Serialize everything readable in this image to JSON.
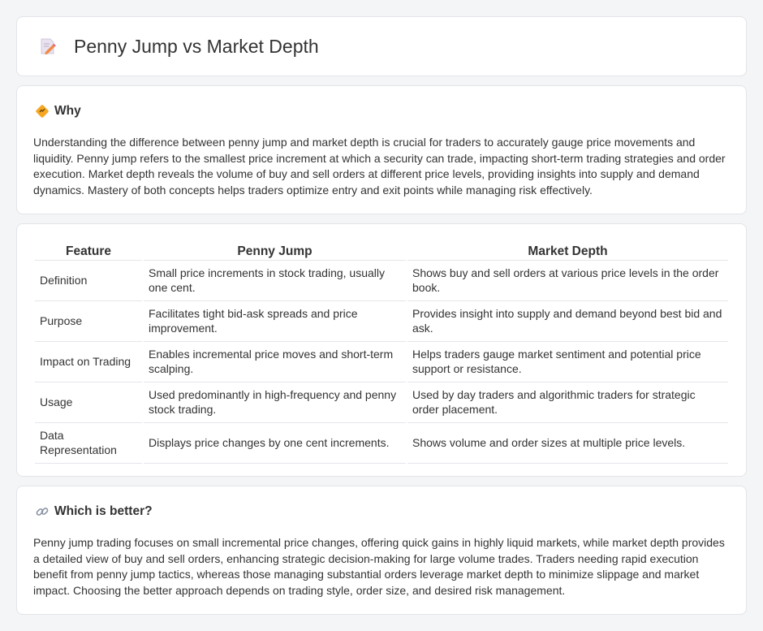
{
  "header": {
    "title": "Penny Jump vs Market Depth",
    "icon": "document-pencil-icon"
  },
  "why": {
    "icon": "diamond-signal-icon",
    "title": "Why",
    "body": "Understanding the difference between penny jump and market depth is crucial for traders to accurately gauge price movements and liquidity. Penny jump refers to the smallest price increment at which a security can trade, impacting short-term trading strategies and order execution. Market depth reveals the volume of buy and sell orders at different price levels, providing insights into supply and demand dynamics. Mastery of both concepts helps traders optimize entry and exit points while managing risk effectively."
  },
  "table": {
    "headers": [
      "Feature",
      "Penny Jump",
      "Market Depth"
    ],
    "rows": [
      [
        "Definition",
        "Small price increments in stock trading, usually one cent.",
        "Shows buy and sell orders at various price levels in the order book."
      ],
      [
        "Purpose",
        "Facilitates tight bid-ask spreads and price improvement.",
        "Provides insight into supply and demand beyond best bid and ask."
      ],
      [
        "Impact on Trading",
        "Enables incremental price moves and short-term scalping.",
        "Helps traders gauge market sentiment and potential price support or resistance."
      ],
      [
        "Usage",
        "Used predominantly in high-frequency and penny stock trading.",
        "Used by day traders and algorithmic traders for strategic order placement."
      ],
      [
        "Data Representation",
        "Displays price changes by one cent increments.",
        "Shows volume and order sizes at multiple price levels."
      ]
    ]
  },
  "better": {
    "icon": "link-icon",
    "title": "Which is better?",
    "body": "Penny jump trading focuses on small incremental price changes, offering quick gains in highly liquid markets, while market depth provides a detailed view of buy and sell orders, enhancing strategic decision-making for large volume trades. Traders needing rapid execution benefit from penny jump tactics, whereas those managing substantial orders leverage market depth to minimize slippage and market impact. Choosing the better approach depends on trading style, order size, and desired risk management."
  }
}
